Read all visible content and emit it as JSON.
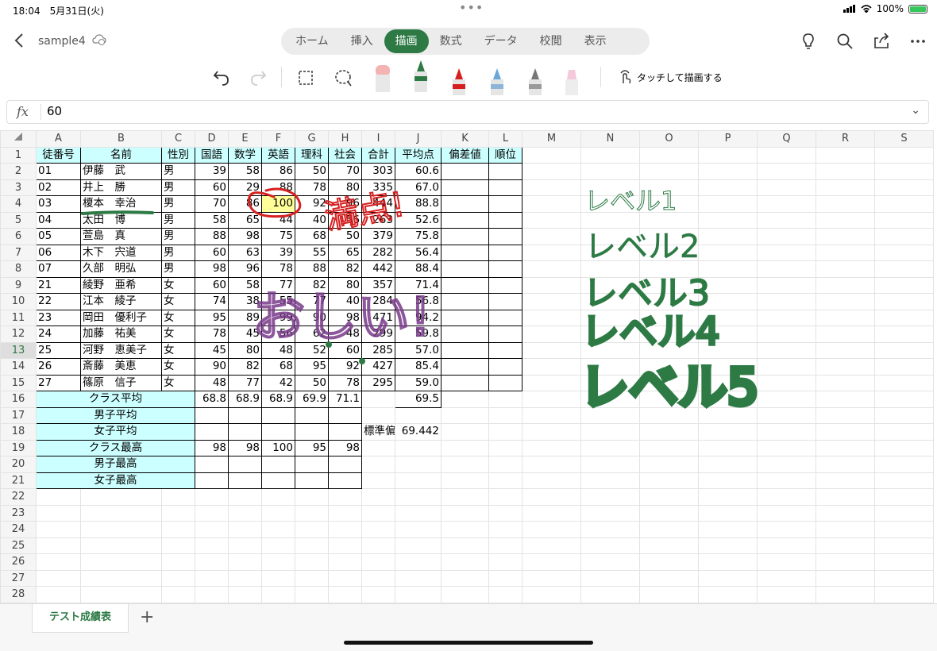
{
  "status": {
    "time": "18:04",
    "date": "5月31日(火)",
    "battery": "100%"
  },
  "file": {
    "name": "sample4"
  },
  "ribbon_tabs": [
    "ホーム",
    "挿入",
    "描画",
    "数式",
    "データ",
    "校閲",
    "表示"
  ],
  "active_tab": "描画",
  "toolbar": {
    "touch_draw_label": "タッチして描画する"
  },
  "formula_bar": {
    "fx": "fx",
    "value": "60"
  },
  "columns": [
    "A",
    "B",
    "C",
    "D",
    "E",
    "F",
    "G",
    "H",
    "I",
    "J",
    "K",
    "L",
    "M",
    "N",
    "O",
    "P",
    "Q",
    "R",
    "S"
  ],
  "rows": [
    [
      "徒番号",
      "名前",
      "性別",
      "国語",
      "数学",
      "英語",
      "理科",
      "社会",
      "合計",
      "平均点",
      "偏差値",
      "順位"
    ],
    [
      "01",
      "伊藤　武",
      "男",
      "39",
      "58",
      "86",
      "50",
      "70",
      "303",
      "60.6",
      "",
      ""
    ],
    [
      "02",
      "井上　勝",
      "男",
      "60",
      "29",
      "88",
      "78",
      "80",
      "335",
      "67.0",
      "",
      ""
    ],
    [
      "03",
      "榎本　幸治",
      "男",
      "70",
      "86",
      "100",
      "92",
      "96",
      "444",
      "88.8",
      "",
      ""
    ],
    [
      "04",
      "太田　博",
      "男",
      "58",
      "65",
      "44",
      "40",
      "56",
      "263",
      "52.6",
      "",
      ""
    ],
    [
      "05",
      "萱島　真",
      "男",
      "88",
      "98",
      "75",
      "68",
      "50",
      "379",
      "75.8",
      "",
      ""
    ],
    [
      "06",
      "木下　宍道",
      "男",
      "60",
      "63",
      "39",
      "55",
      "65",
      "282",
      "56.4",
      "",
      ""
    ],
    [
      "07",
      "久部　明弘",
      "男",
      "98",
      "96",
      "78",
      "88",
      "82",
      "442",
      "88.4",
      "",
      ""
    ],
    [
      "21",
      "綾野　亜希",
      "女",
      "60",
      "58",
      "77",
      "82",
      "80",
      "357",
      "71.4",
      "",
      ""
    ],
    [
      "22",
      "江本　綾子",
      "女",
      "74",
      "38",
      "55",
      "77",
      "40",
      "284",
      "56.8",
      "",
      ""
    ],
    [
      "23",
      "岡田　優利子",
      "女",
      "95",
      "89",
      "99",
      "90",
      "98",
      "471",
      "94.2",
      "",
      ""
    ],
    [
      "24",
      "加藤　祐美",
      "女",
      "78",
      "45",
      "56",
      "62",
      "48",
      "299",
      "59.8",
      "",
      ""
    ],
    [
      "25",
      "河野　恵美子",
      "女",
      "45",
      "80",
      "48",
      "52",
      "60",
      "285",
      "57.0",
      "",
      ""
    ],
    [
      "26",
      "斎藤　美恵",
      "女",
      "90",
      "82",
      "68",
      "95",
      "92",
      "427",
      "85.4",
      "",
      ""
    ],
    [
      "27",
      "篠原　信子",
      "女",
      "48",
      "77",
      "42",
      "50",
      "78",
      "295",
      "59.0",
      "",
      ""
    ]
  ],
  "summary": [
    {
      "label": "クラス平均",
      "values": [
        "68.8",
        "68.9",
        "68.9",
        "69.9",
        "71.1"
      ],
      "avg": "69.5"
    },
    {
      "label": "男子平均",
      "values": [
        "",
        "",
        "",
        "",
        ""
      ]
    },
    {
      "label": "女子平均",
      "values": [
        "",
        "",
        "",
        "",
        ""
      ],
      "std_label": "標準偏差",
      "std_value": "69.442"
    },
    {
      "label": "クラス最高",
      "values": [
        "98",
        "98",
        "100",
        "95",
        "98"
      ]
    },
    {
      "label": "男子最高",
      "values": [
        "",
        "",
        "",
        "",
        ""
      ]
    },
    {
      "label": "女子最高",
      "values": [
        "",
        "",
        "",
        "",
        ""
      ]
    }
  ],
  "row_numbers": [
    "1",
    "2",
    "3",
    "4",
    "5",
    "6",
    "7",
    "8",
    "9",
    "10",
    "11",
    "12",
    "13",
    "14",
    "15",
    "16",
    "17",
    "18",
    "19",
    "20",
    "21",
    "22",
    "23",
    "24",
    "25",
    "26",
    "27",
    "28"
  ],
  "ink": {
    "levels": [
      "レベル1",
      "レベル2",
      "レベル3",
      "レベル4",
      "レベル5"
    ],
    "red_note": "満点!",
    "purple_note": "おしい!"
  },
  "sheet_tab": "テスト成績表",
  "colors": {
    "accent": "#2d7a45",
    "header_fill": "#ccffff",
    "highlight": "#ffff99"
  }
}
